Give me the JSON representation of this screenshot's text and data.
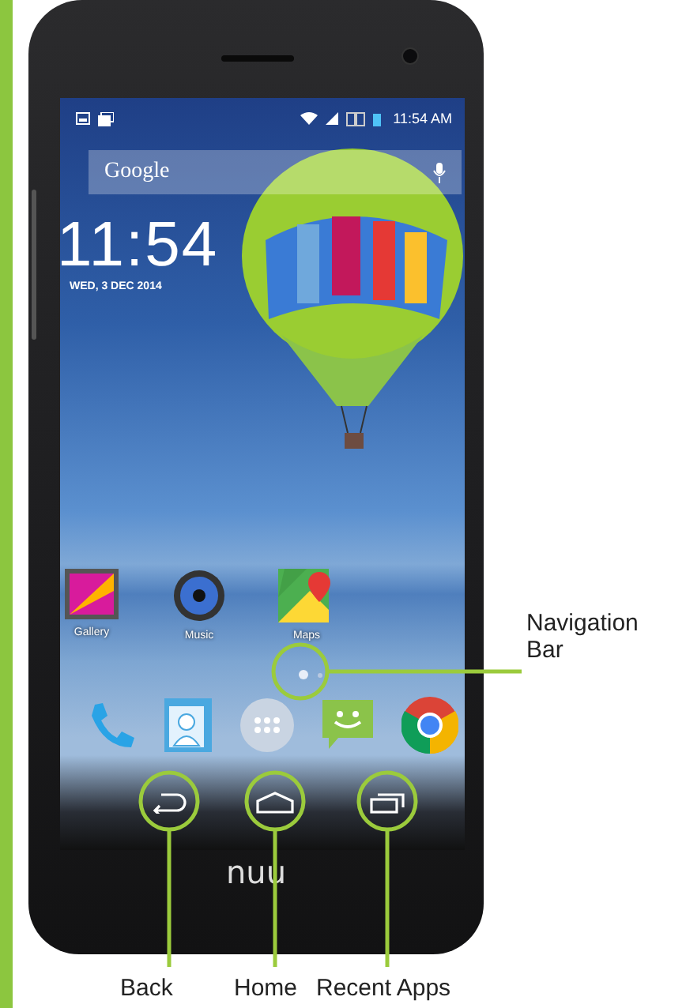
{
  "status_bar": {
    "time": "11:54 AM"
  },
  "search": {
    "label": "Google"
  },
  "clock": {
    "time": "11:54",
    "date": "WED, 3 DEC 2014"
  },
  "apps": [
    {
      "label": "Gallery"
    },
    {
      "label": "Music"
    },
    {
      "label": "Maps"
    }
  ],
  "page_indicator": [
    {
      "selected": true
    },
    {
      "selected": false
    }
  ],
  "brand": {
    "logo": "nuu"
  },
  "callouts": [
    {
      "label": "Navigation Bar"
    },
    {
      "label": "Back"
    },
    {
      "label": "Home"
    },
    {
      "label": "Recent Apps"
    }
  ]
}
